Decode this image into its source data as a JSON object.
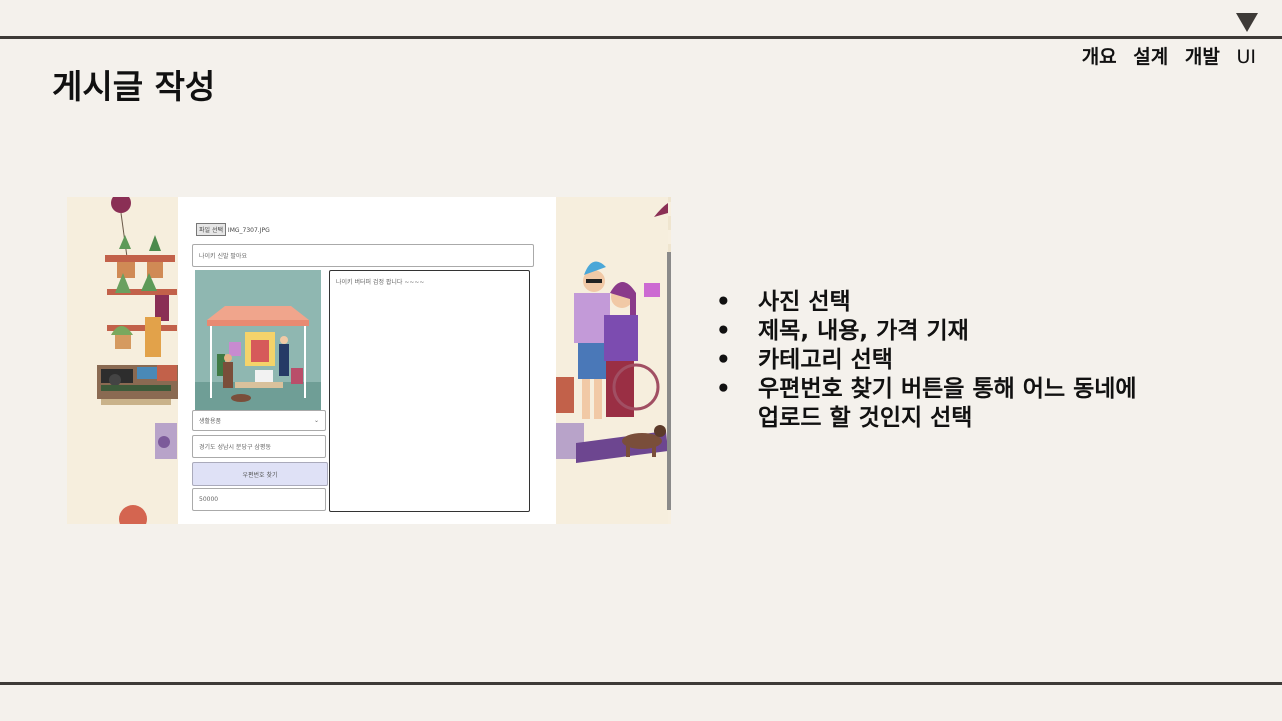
{
  "header": {
    "nav": [
      "개요",
      "설계",
      "개발"
    ],
    "nav_tail": "UI"
  },
  "slide": {
    "title": "게시글 작성"
  },
  "screenshot": {
    "file_button": "파일 선택",
    "file_name": "IMG_7307.JPG",
    "title_value": "나이키 신발 팔아요",
    "content_value": "나이키 버터퍼 검정 팝니다 ~~~~",
    "category_value": "생활용품",
    "address_value": "경기도 성남시 분당구 삼평동",
    "zip_button": "우편번호 찾기",
    "price_value": "50000"
  },
  "bullets": [
    {
      "line1": "사진 선택"
    },
    {
      "line1": "제목, 내용, 가격 기재"
    },
    {
      "line1": "카테고리 선택"
    },
    {
      "line1": "우편번호 찾기 버튼을 통해 어느 동네에",
      "line2": "업로드 할 것인지 선택"
    }
  ],
  "colors": {
    "rule": "#3d3a37",
    "background": "#f4f1ec",
    "zip_button": "#dfe1f6"
  }
}
